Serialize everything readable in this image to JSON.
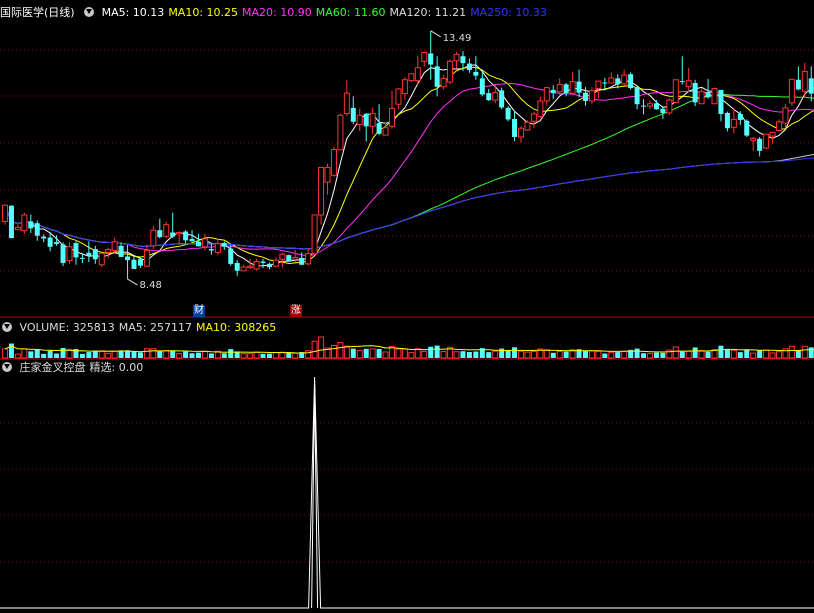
{
  "stock": {
    "title": "国际医学(日线)"
  },
  "price_header": {
    "items": [
      {
        "label": "MA5: 10.13",
        "color": "#ffffff"
      },
      {
        "label": "MA10: 10.25",
        "color": "#ffff00"
      },
      {
        "label": "MA20: 10.90",
        "color": "#ff33ff"
      },
      {
        "label": "MA60: 11.60",
        "color": "#33ff33"
      },
      {
        "label": "MA120: 11.21",
        "color": "#dcdcdc"
      },
      {
        "label": "MA250: 10.33",
        "color": "#3333ff"
      }
    ]
  },
  "volume_header": {
    "items": [
      {
        "label": "VOLUME: 325813",
        "color": "#dcdcdc"
      },
      {
        "label": "MA5: 257117",
        "color": "#dcdcdc"
      },
      {
        "label": "MA10: 308265",
        "color": "#ffff00"
      }
    ]
  },
  "indicator_header": {
    "items": [
      {
        "label": "庄家金叉控盘",
        "color": "#dcdcdc"
      },
      {
        "label": "精选: 0.00",
        "color": "#dcdcdc"
      }
    ]
  },
  "markers": {
    "high_label": "13.49",
    "low_label": "8.48",
    "tag_cai": "财",
    "tag_zhang": "涨"
  },
  "colors": {
    "up": "#ff3232",
    "down": "#54ffff",
    "grid": "#8b0000",
    "bg": "#000000"
  },
  "chart_data": {
    "type": "candlestick",
    "candles": [
      [
        10.35,
        10.7,
        10.72,
        10.28
      ],
      [
        10.69,
        9.99,
        10.7,
        9.98
      ],
      [
        10.17,
        10.22,
        10.28,
        10.17
      ],
      [
        10.15,
        10.49,
        10.54,
        10.08
      ],
      [
        10.35,
        10.2,
        10.5,
        10.1
      ],
      [
        10.31,
        10.04,
        10.37,
        9.93
      ],
      [
        10.02,
        9.98,
        10.07,
        9.9
      ],
      [
        10.0,
        9.8,
        10.12,
        9.7
      ],
      [
        9.9,
        9.86,
        10.05,
        9.82
      ],
      [
        9.85,
        9.45,
        9.9,
        9.38
      ],
      [
        9.5,
        9.8,
        9.9,
        9.43
      ],
      [
        9.88,
        9.57,
        9.92,
        9.41
      ],
      [
        9.56,
        9.54,
        9.66,
        9.45
      ],
      [
        9.67,
        9.61,
        9.92,
        9.47
      ],
      [
        9.75,
        9.53,
        9.82,
        9.43
      ],
      [
        9.41,
        9.66,
        9.67,
        9.36
      ],
      [
        9.68,
        9.74,
        9.78,
        9.55
      ],
      [
        9.72,
        9.91,
        10.0,
        9.65
      ],
      [
        9.82,
        9.58,
        9.89,
        9.58
      ],
      [
        9.59,
        9.51,
        9.84,
        9.1
      ],
      [
        9.52,
        9.32,
        9.59,
        9.32
      ],
      [
        9.53,
        9.39,
        9.57,
        9.34
      ],
      [
        9.38,
        9.72,
        9.85,
        9.36
      ],
      [
        9.82,
        10.16,
        10.25,
        9.75
      ],
      [
        10.16,
        10.01,
        10.41,
        9.98
      ],
      [
        10.03,
        10.28,
        10.34,
        9.99
      ],
      [
        10.11,
        10.02,
        10.54,
        9.99
      ],
      [
        10.08,
        10.11,
        10.12,
        9.88
      ],
      [
        10.13,
        9.94,
        10.16,
        9.88
      ],
      [
        9.97,
        9.92,
        10.16,
        9.91
      ],
      [
        9.91,
        9.81,
        10.08,
        9.81
      ],
      [
        9.8,
        9.97,
        10.08,
        9.72
      ],
      [
        9.75,
        9.72,
        9.89,
        9.63
      ],
      [
        9.68,
        9.87,
        9.97,
        9.63
      ],
      [
        9.88,
        9.8,
        9.92,
        9.73
      ],
      [
        9.76,
        9.43,
        9.84,
        9.39
      ],
      [
        9.45,
        9.28,
        9.51,
        9.17
      ],
      [
        9.28,
        9.36,
        9.41,
        9.27
      ],
      [
        9.35,
        9.38,
        9.54,
        9.32
      ],
      [
        9.32,
        9.48,
        9.54,
        9.29
      ],
      [
        9.48,
        9.45,
        9.54,
        9.34
      ],
      [
        9.43,
        9.36,
        9.46,
        9.31
      ],
      [
        9.38,
        9.51,
        9.57,
        9.36
      ],
      [
        9.53,
        9.64,
        9.67,
        9.35
      ],
      [
        9.62,
        9.48,
        9.63,
        9.48
      ],
      [
        9.53,
        9.57,
        9.73,
        9.46
      ],
      [
        9.56,
        9.41,
        9.68,
        9.41
      ],
      [
        9.43,
        9.65,
        9.77,
        9.4
      ],
      [
        9.65,
        10.49,
        10.5,
        9.65
      ],
      [
        10.49,
        11.52,
        11.52,
        10.28
      ],
      [
        11.2,
        11.52,
        11.6,
        10.93
      ],
      [
        11.35,
        11.91,
        11.97,
        11.32
      ],
      [
        11.9,
        12.65,
        12.69,
        11.9
      ],
      [
        12.69,
        13.13,
        13.41,
        12.63
      ],
      [
        12.81,
        12.51,
        13.06,
        12.46
      ],
      [
        12.45,
        12.65,
        12.79,
        12.31
      ],
      [
        12.68,
        12.41,
        12.7,
        12.08
      ],
      [
        12.41,
        12.69,
        12.82,
        12.24
      ],
      [
        12.48,
        12.25,
        12.89,
        12.22
      ],
      [
        12.22,
        12.38,
        12.49,
        12.22
      ],
      [
        12.41,
        12.8,
        13.18,
        12.36
      ],
      [
        12.89,
        13.22,
        13.24,
        12.78
      ],
      [
        13.12,
        13.42,
        13.48,
        12.99
      ],
      [
        13.4,
        13.55,
        13.55,
        13.37
      ],
      [
        13.4,
        13.68,
        13.94,
        13.32
      ],
      [
        13.82,
        14.01,
        14.02,
        13.7
      ],
      [
        13.99,
        13.75,
        14.48,
        13.42
      ],
      [
        13.71,
        13.27,
        13.93,
        13.06
      ],
      [
        13.27,
        13.45,
        13.52,
        13.21
      ],
      [
        13.37,
        13.82,
        13.86,
        13.32
      ],
      [
        13.83,
        13.97,
        14.02,
        13.67
      ],
      [
        13.93,
        13.78,
        14.04,
        13.61
      ],
      [
        13.77,
        13.63,
        13.88,
        13.57
      ],
      [
        13.59,
        13.51,
        13.93,
        13.42
      ],
      [
        13.45,
        13.1,
        13.64,
        13.06
      ],
      [
        13.13,
        12.98,
        13.22,
        12.96
      ],
      [
        12.98,
        13.14,
        13.32,
        12.91
      ],
      [
        13.19,
        12.82,
        13.25,
        12.78
      ],
      [
        12.81,
        12.56,
        12.85,
        12.52
      ],
      [
        12.57,
        12.18,
        12.75,
        12.09
      ],
      [
        12.18,
        12.37,
        12.41,
        12.06
      ],
      [
        12.33,
        12.5,
        12.54,
        12.31
      ],
      [
        12.52,
        12.68,
        12.73,
        12.37
      ],
      [
        12.62,
        12.96,
        13.05,
        12.59
      ],
      [
        12.96,
        13.25,
        13.27,
        12.86
      ],
      [
        13.2,
        13.13,
        13.3,
        13.0
      ],
      [
        13.16,
        13.32,
        13.45,
        13.09
      ],
      [
        13.32,
        13.13,
        13.35,
        13.06
      ],
      [
        13.13,
        13.38,
        13.59,
        13.1
      ],
      [
        13.38,
        13.14,
        13.64,
        13.04
      ],
      [
        13.14,
        12.96,
        13.26,
        12.86
      ],
      [
        12.96,
        13.18,
        13.26,
        12.9
      ],
      [
        13.23,
        13.39,
        13.4,
        13.02
      ],
      [
        13.36,
        13.34,
        13.46,
        13.19
      ],
      [
        13.35,
        13.46,
        13.58,
        13.34
      ],
      [
        13.45,
        13.32,
        13.54,
        13.23
      ],
      [
        13.33,
        13.52,
        13.64,
        13.3
      ],
      [
        13.54,
        13.24,
        13.58,
        13.21
      ],
      [
        13.24,
        12.89,
        13.28,
        12.78
      ],
      [
        12.86,
        12.84,
        13.0,
        12.67
      ],
      [
        12.85,
        12.9,
        12.97,
        12.78
      ],
      [
        12.91,
        12.78,
        12.98,
        12.77
      ],
      [
        12.79,
        12.7,
        12.82,
        12.57
      ],
      [
        12.7,
        12.98,
        13.02,
        12.65
      ],
      [
        12.93,
        13.42,
        13.42,
        12.91
      ],
      [
        13.39,
        13.37,
        13.93,
        13.32
      ],
      [
        13.27,
        13.4,
        13.68,
        13.2
      ],
      [
        13.35,
        12.93,
        13.42,
        12.85
      ],
      [
        12.9,
        13.16,
        13.23,
        12.9
      ],
      [
        13.15,
        13.04,
        13.44,
        13.01
      ],
      [
        12.9,
        13.23,
        13.25,
        12.9
      ],
      [
        13.2,
        12.68,
        13.2,
        12.52
      ],
      [
        12.7,
        12.37,
        12.73,
        12.3
      ],
      [
        12.39,
        12.56,
        12.81,
        12.26
      ],
      [
        12.68,
        12.55,
        12.74,
        12.44
      ],
      [
        12.53,
        12.21,
        12.56,
        12.18
      ],
      [
        12.1,
        12.15,
        12.18,
        11.88
      ],
      [
        12.14,
        11.88,
        12.18,
        11.76
      ],
      [
        11.94,
        12.24,
        12.24,
        11.92
      ],
      [
        12.2,
        12.28,
        12.29,
        12.03
      ],
      [
        12.32,
        12.51,
        12.56,
        12.3
      ],
      [
        12.48,
        12.81,
        12.89,
        12.39
      ],
      [
        12.92,
        13.43,
        13.44,
        12.85
      ],
      [
        13.42,
        13.21,
        13.71,
        13.19
      ],
      [
        13.17,
        13.6,
        13.79,
        13.03
      ],
      [
        13.45,
        13.12,
        13.71,
        12.95
      ],
      [
        13.13,
        12.93,
        13.14,
        12.88
      ]
    ],
    "volume_ma10_line": true,
    "indicator": {
      "name": "精选",
      "peak_at_index": 48,
      "peak_value": 1
    }
  }
}
